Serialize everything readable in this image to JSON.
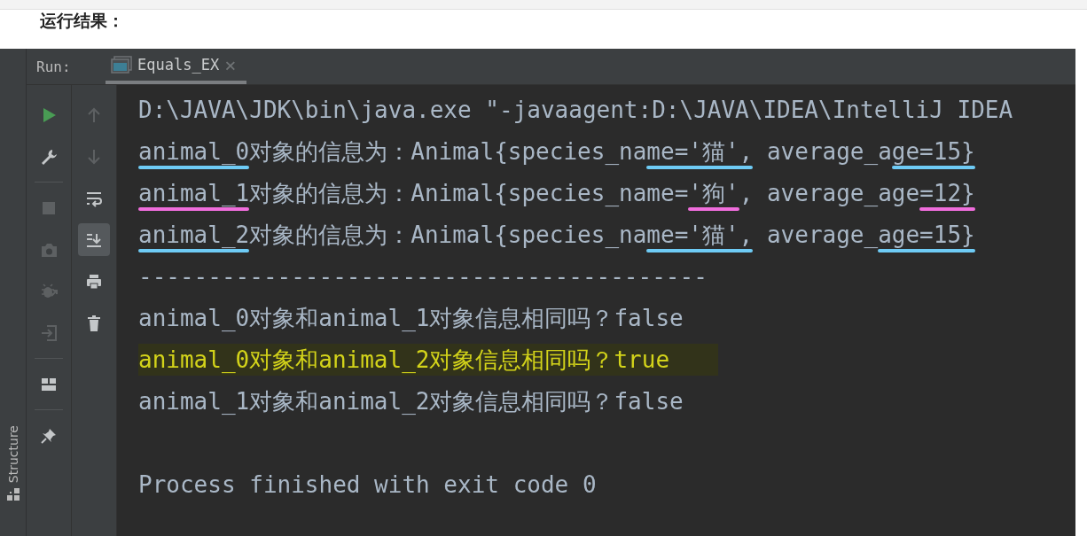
{
  "page_heading": "运行结果：",
  "side_strip": {
    "tab": "Structure"
  },
  "run_bar": {
    "label": "Run:",
    "tabs": [
      {
        "label": "Equals_EX",
        "selected": true,
        "close": "×"
      }
    ]
  },
  "toolbar_left": [
    {
      "kind": "button",
      "disabled": false
    },
    {
      "kind": "button",
      "disabled": false
    },
    {
      "kind": "separator"
    },
    {
      "kind": "button",
      "disabled": true
    },
    {
      "kind": "button",
      "disabled": true
    },
    {
      "kind": "button",
      "disabled": true
    },
    {
      "kind": "button",
      "disabled": true
    },
    {
      "kind": "separator"
    },
    {
      "kind": "button",
      "disabled": false
    },
    {
      "kind": "separator"
    },
    {
      "kind": "button",
      "disabled": false
    }
  ],
  "toolbar_right": [
    {
      "disabled": true,
      "selected": false
    },
    {
      "disabled": true,
      "selected": false
    },
    {
      "disabled": false,
      "selected": false
    },
    {
      "disabled": false,
      "selected": true
    },
    {
      "disabled": false,
      "selected": false
    },
    {
      "disabled": false,
      "selected": false
    }
  ],
  "console": {
    "lines": [
      {
        "kind": "text",
        "segments": [
          {
            "text": "D:\\JAVA\\JDK\\bin\\java.exe \"-javaagent:D:\\JAVA\\IDEA\\IntelliJ IDEA"
          }
        ]
      },
      {
        "kind": "text",
        "segments": [
          {
            "text": "animal_0",
            "color": "#6ecbf5"
          },
          {
            "text": "对象的信息为：Animal{species_na"
          },
          {
            "text": "me='猫',",
            "color": "#6ecbf5"
          },
          {
            "text": " average_a"
          },
          {
            "text": "ge=15}",
            "color": "#6ecbf5"
          }
        ]
      },
      {
        "kind": "text",
        "segments": [
          {
            "text": "animal_1",
            "color": "#f06ddc"
          },
          {
            "text": "对象的信息为：Animal{species_name="
          },
          {
            "text": "'狗'",
            "color": "#f06ddc"
          },
          {
            "text": ", average_age"
          },
          {
            "text": "=12}",
            "color": "#f06ddc"
          }
        ]
      },
      {
        "kind": "text",
        "segments": [
          {
            "text": "animal_2",
            "color": "#6ecbf5"
          },
          {
            "text": "对象的信息为：Animal{species_na"
          },
          {
            "text": "me='猫',",
            "color": "#6ecbf5"
          },
          {
            "text": " average_"
          },
          {
            "text": "age=15}",
            "color": "#6ecbf5"
          }
        ]
      },
      {
        "kind": "text",
        "segments": [
          {
            "text": "-----------------------------------------"
          }
        ]
      },
      {
        "kind": "text",
        "segments": [
          {
            "text": "animal_0对象和animal_1对象信息相同吗？false"
          }
        ]
      },
      {
        "kind": "text",
        "highlighted": true,
        "segments": [
          {
            "text": "animal_0对象和animal_2对象信息相同吗？true"
          }
        ]
      },
      {
        "kind": "text",
        "segments": [
          {
            "text": "animal_1对象和animal_2对象信息相同吗？false"
          }
        ]
      },
      {
        "kind": "blank"
      },
      {
        "kind": "text",
        "segments": [
          {
            "text": "Process finished with exit code 0"
          }
        ]
      }
    ]
  }
}
